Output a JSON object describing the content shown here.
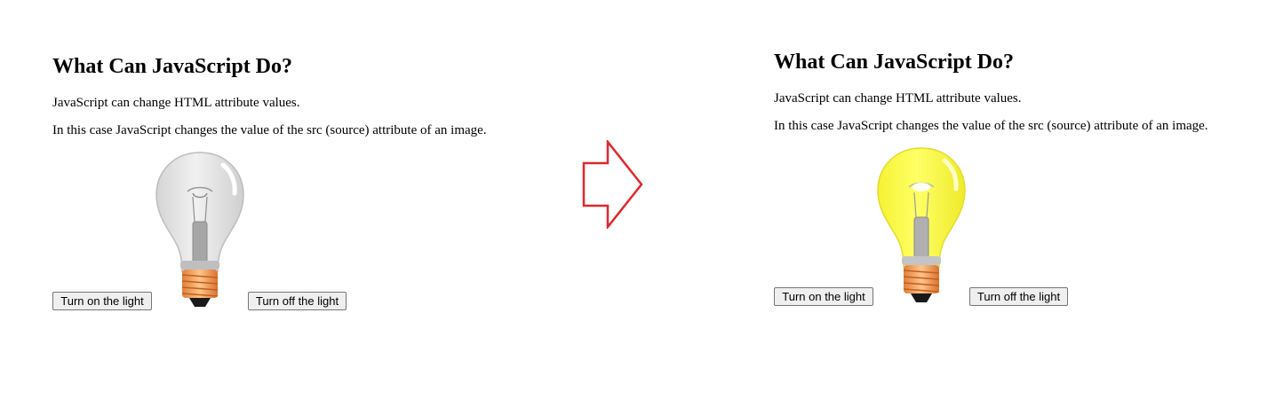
{
  "left_panel": {
    "heading": "What Can JavaScript Do?",
    "paragraph_1": "JavaScript can change HTML attribute values.",
    "paragraph_2": "In this case JavaScript changes the value of the src (source) attribute of an image.",
    "button_on_label": "Turn on the light",
    "button_off_label": "Turn off the light",
    "bulb_state": "off",
    "bulb_color": "#e6e6e6"
  },
  "arrow": {
    "icon": "right-arrow-icon",
    "color": "#e0262c"
  },
  "right_panel": {
    "heading": "What Can JavaScript Do?",
    "paragraph_1": "JavaScript can change HTML attribute values.",
    "paragraph_2": "In this case JavaScript changes the value of the src (source) attribute of an image.",
    "button_on_label": "Turn on the light",
    "button_off_label": "Turn off the light",
    "bulb_state": "on",
    "bulb_color": "#ffff4d"
  }
}
